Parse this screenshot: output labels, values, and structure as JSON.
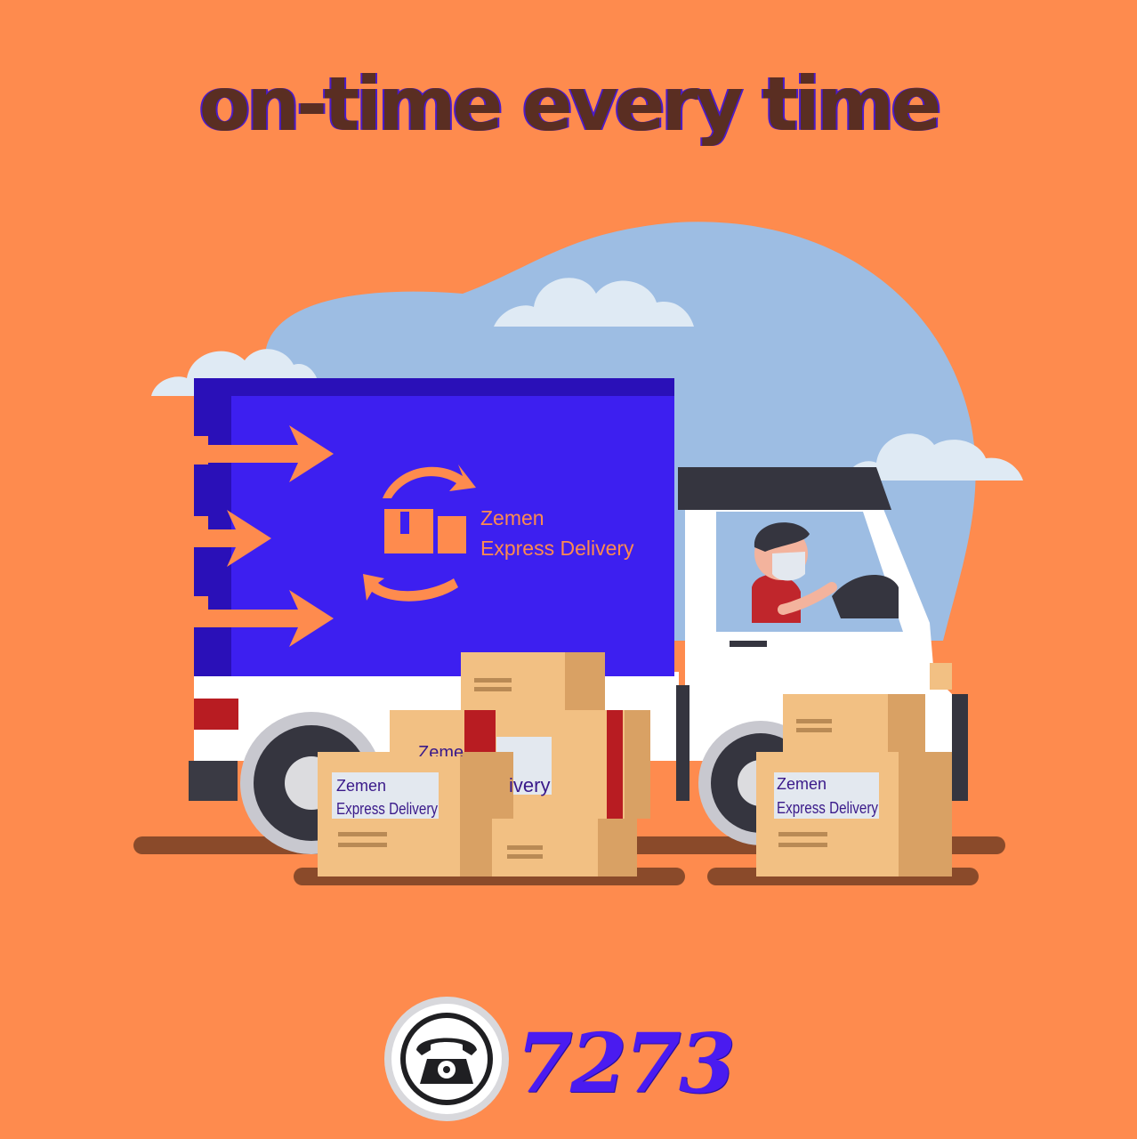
{
  "headline": "on-time every time",
  "brand": {
    "line1": "Zemen",
    "line2": "Express Delivery"
  },
  "box_labels": [
    {
      "line1": "Zemen",
      "line2": "Express Delivery"
    },
    {
      "line1": "Zemen",
      "line2": "Express Delivery"
    },
    {
      "partial_line1": "Zemen",
      "partial_line2": "ivery"
    }
  ],
  "contact": {
    "phone_number": "7273",
    "icon": "telephone-icon"
  },
  "colors": {
    "background": "#fe8b4e",
    "truck_body": "#3d1ff0",
    "sky_blob": "#9dbde3",
    "headline": "#5a2e22",
    "phone_number": "#4a1bf0",
    "box": "#f2c083"
  }
}
